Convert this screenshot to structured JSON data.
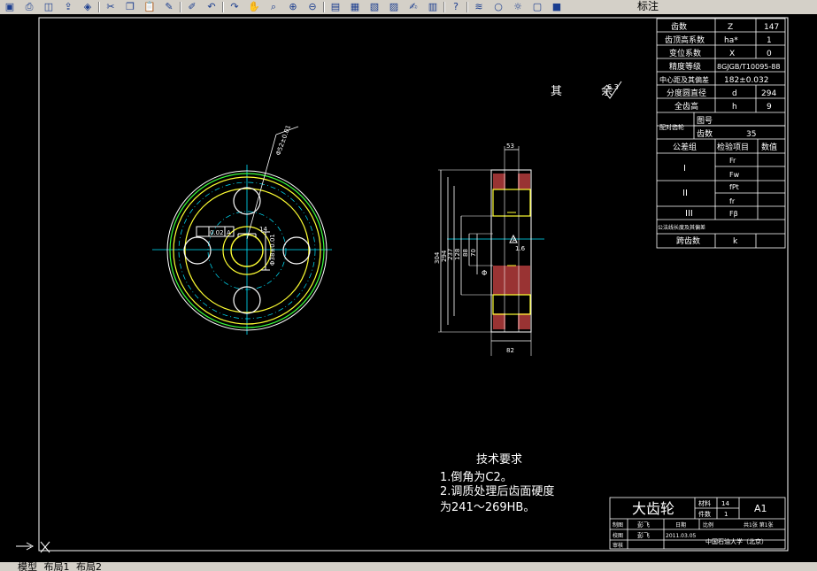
{
  "toolbar": {
    "icons": [
      "save-icon",
      "print-icon",
      "print-preview-icon",
      "publish-icon",
      "plot-icon",
      "cut-icon",
      "copy-icon",
      "paste-icon",
      "match-properties-icon",
      "block-editor-icon",
      "undo-icon",
      "redo-icon",
      "pan-icon",
      "zoom-realtime-icon",
      "zoom-window-icon",
      "zoom-previous-icon",
      "properties-icon",
      "design-center-icon",
      "tool-palettes-icon",
      "sheet-set-icon",
      "markup-icon",
      "calculator-icon",
      "help-icon",
      "layer-properties-icon",
      "lightbulb-icon",
      "sun-icon",
      "layer-lock-icon",
      "color-swatch-icon"
    ],
    "layer_name": "标注"
  },
  "drawing": {
    "sidebar_label": "其 余",
    "roughness_value": "6.3",
    "gear": {
      "leader_note": "Φ52±0.01",
      "flatness_box": "0.02",
      "datum": "A",
      "keyway_width": "14",
      "bore_dim": "Φ38±0.01"
    },
    "section": {
      "top_dim": "53",
      "bottom_dim": "82",
      "dims": [
        "304",
        "294",
        "237",
        "128",
        "88",
        "70"
      ],
      "phi_mark": "Φ",
      "roughness": "1.6",
      "datum": "A"
    },
    "params": [
      {
        "name": "齿数",
        "symbol": "Z",
        "value": "147"
      },
      {
        "name": "齿顶高系数",
        "symbol": "ha*",
        "value": "1"
      },
      {
        "name": "变位系数",
        "symbol": "X",
        "value": "0"
      },
      {
        "name": "精度等级",
        "symbol": "8GJGB/T10095-88",
        "value": ""
      },
      {
        "name": "中心距及其偏差",
        "symbol": "182±0.032",
        "value": ""
      },
      {
        "name": "分度圆直径",
        "symbol": "d",
        "value": "294"
      },
      {
        "name": "全齿高",
        "symbol": "h",
        "value": "9"
      }
    ],
    "mating": {
      "label": "配对齿轮",
      "drawing_no": "图号",
      "teeth": "齿数",
      "teeth_value": "35"
    },
    "tolerance": {
      "headers": [
        "公差组",
        "检验项目",
        "数值"
      ],
      "groups": [
        {
          "group": "I",
          "items": [
            "Fr",
            "Fw"
          ]
        },
        {
          "group": "II",
          "items": [
            "fPt",
            "fr"
          ]
        },
        {
          "group": "III",
          "items": [
            "Fβ"
          ]
        }
      ],
      "normal_length": "公法线长度及其偏差",
      "span": "跨齿数",
      "span_symbol": "k"
    },
    "tech": {
      "title": "技术要求",
      "lines": [
        "1.倒角为C2。",
        "2.调质处理后齿面硬度",
        "为241～269HB。"
      ]
    },
    "title_block": {
      "part_name": "大齿轮",
      "material_label": "材料",
      "material_value": "14",
      "quantity_label": "件数",
      "quantity_value": "1",
      "sheet": "A1",
      "drawn_label": "制图",
      "drawn_name": "彭飞",
      "date_label": "日期",
      "date_value": "2011.03.05",
      "checked_label": "校图",
      "checked_name": "彭飞",
      "approved_label": "审核",
      "scale_label": "比例",
      "sheets_label": "共1张 第1张",
      "school": "中国石油大学（北京）"
    }
  },
  "layout_tabs": [
    "模型",
    "布局1",
    "布局2"
  ]
}
